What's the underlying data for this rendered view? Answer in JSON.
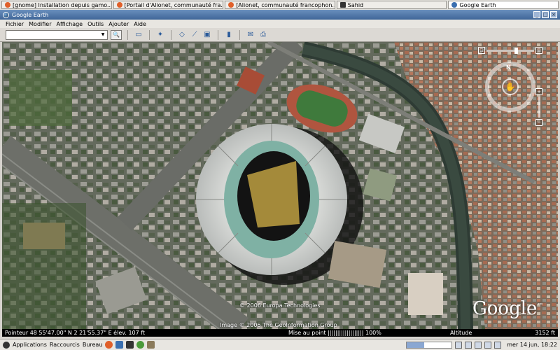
{
  "tabs": [
    {
      "label": "[gnome] Installation depuis gamo...",
      "icon": "firefox-icon",
      "color": "#e0602a"
    },
    {
      "label": "[Portail d'Alionet, communauté fra...",
      "icon": "firefox-icon",
      "color": "#e0602a"
    },
    {
      "label": "[Alionet, communauté francophon...",
      "icon": "firefox-icon",
      "color": "#e0602a"
    },
    {
      "label": "Sahid",
      "icon": "terminal-icon",
      "color": "#333333"
    },
    {
      "label": "Google Earth",
      "icon": "earth-icon",
      "color": "#3a6fb0"
    }
  ],
  "window": {
    "title": "Google Earth",
    "btn_min": "_",
    "btn_max": "□",
    "btn_close": "×"
  },
  "menu": [
    "Fichier",
    "Modifier",
    "Affichage",
    "Outils",
    "Ajouter",
    "Aide"
  ],
  "search": {
    "value": "",
    "search_icon": "🔍"
  },
  "toolbar_icons": [
    "sidebar-icon",
    "placemark-icon",
    "polygon-icon",
    "path-icon",
    "overlay-icon",
    "ruler-icon",
    "email-icon",
    "print-icon"
  ],
  "toolbar_glyphs": [
    "▭",
    "✦",
    "◇",
    "⟋",
    "▣",
    "▮",
    "✉",
    "⎙"
  ],
  "nav": {
    "north": "N",
    "center": "✋",
    "zoom_in": "+",
    "zoom_out": "−",
    "look": "◉"
  },
  "map": {
    "copyright1": "© 2006 Europa Technologies",
    "copyright2": "Image © 2006 The GeoInformation Group",
    "logo": "Google",
    "logo_sup": "™"
  },
  "status": {
    "coords": "Pointeur 48 55'47.00\" N    2 21'55.37\" E   élev.   107 ft",
    "loading": "Mise au point |||||||||||||||||||  100%",
    "alt_label": "Altitude",
    "alt_value": "3152 ft"
  },
  "panel": {
    "applications": "Applications",
    "places": "Raccourcis",
    "desktop": "Bureau",
    "clock": "mer 14 jun, 18:22",
    "progress": 0.38
  }
}
